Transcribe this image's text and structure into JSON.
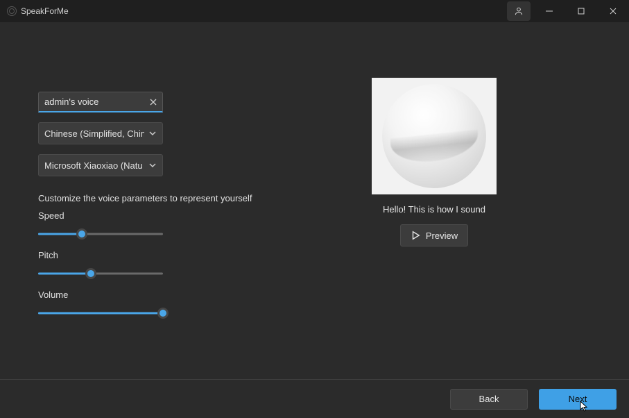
{
  "titlebar": {
    "app_title": "SpeakForMe"
  },
  "form": {
    "voice_name_value": "admin's voice",
    "language_selected": "Chinese (Simplified, Chin",
    "voice_selected": "Microsoft Xiaoxiao (Natu",
    "hint": "Customize the voice parameters to represent yourself",
    "speed_label": "Speed",
    "pitch_label": "Pitch",
    "volume_label": "Volume",
    "speed_pct": 35,
    "pitch_pct": 42,
    "volume_pct": 100
  },
  "preview": {
    "caption": "Hello! This is how I sound",
    "button_label": "Preview"
  },
  "footer": {
    "back_label": "Back",
    "next_label": "Next"
  }
}
